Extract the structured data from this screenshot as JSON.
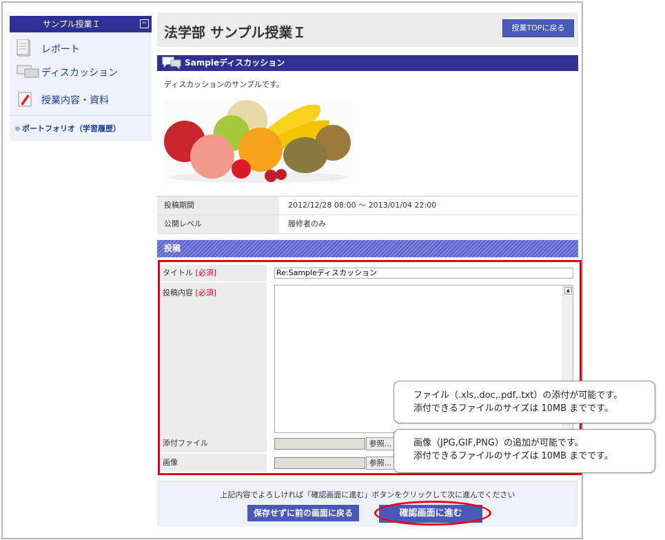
{
  "sidebar": {
    "title": "サンプル授業Ｉ",
    "collapse_glyph": "−",
    "items": [
      {
        "label": "レポート",
        "icon": "document-icon"
      },
      {
        "label": "ディスカッション",
        "icon": "discussion-icon"
      },
      {
        "label": "授業内容・資料",
        "icon": "materials-icon"
      }
    ],
    "portfolio": "ポートフォリオ（学習履歴）"
  },
  "header": {
    "title": "法学部  サンプル授業Ｉ",
    "top_button": "授業TOPに戻る"
  },
  "discussion": {
    "title": "Sampleディスカッション",
    "description": "ディスカッションのサンプルです。",
    "info": [
      {
        "label": "投稿期間",
        "value": "2012/12/28 08:00 〜 2013/01/04 22:00"
      },
      {
        "label": "公開レベル",
        "value": "履修者のみ"
      }
    ]
  },
  "post": {
    "section_title": "投稿",
    "required_mark": "[必須]",
    "title_label": "タイトル",
    "title_value": "Re:Sampleディスカッション",
    "content_label": "投稿内容",
    "attachment_label": "添付ファイル",
    "image_label": "画像",
    "browse_label": "参照..."
  },
  "callouts": {
    "file_line1": "ファイル（.xls,.doc,.pdf,.txt）の添付が可能です。",
    "file_line2": "添付できるファイルのサイズは 10MB までです。",
    "image_line1": "画像（JPG,GIF,PNG）の追加が可能です。",
    "image_line2": "添付できるファイルのサイズは 10MB までです。"
  },
  "footer": {
    "note": "上記内容でよろしければ「確認画面に進む」ボタンをクリックして次に進んでください",
    "back_button": "保存せずに前の画面に戻る",
    "confirm_button": "確認画面に進む"
  },
  "colors": {
    "navy": "#2e3192",
    "button_blue": "#4a59b7",
    "highlight_red": "#e60012"
  }
}
